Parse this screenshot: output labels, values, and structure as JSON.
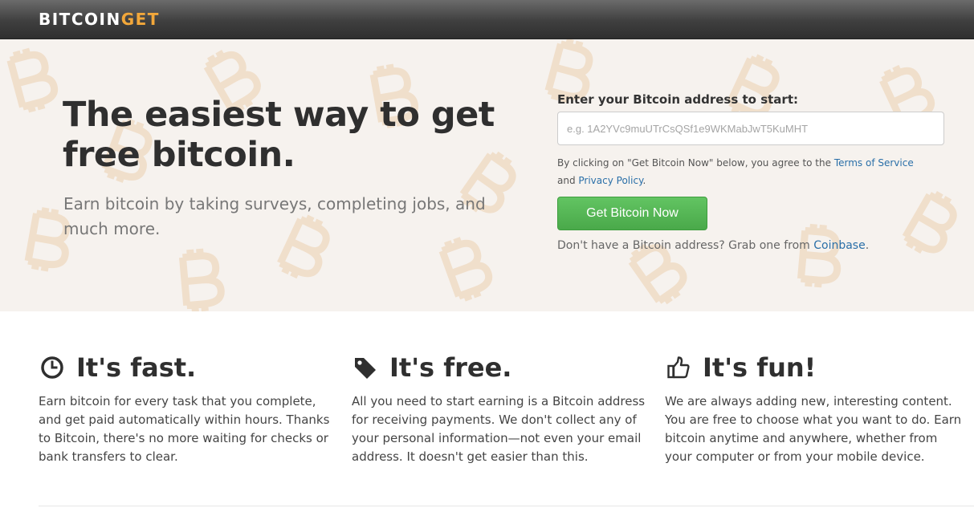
{
  "brand": {
    "part1": "BITCOIN",
    "part2": "GET",
    "accent_color": "#f2a73a"
  },
  "hero": {
    "headline": "The easiest way to get free bitcoin.",
    "subhead": "Earn bitcoin by taking surveys, completing jobs, and much more."
  },
  "signup": {
    "label": "Enter your Bitcoin address to start:",
    "placeholder": "e.g. 1A2YVc9muUTrCsQSf1e9WKMabJwT5KuMHT",
    "terms_prefix": "By clicking on \"Get Bitcoin Now\" below, you agree to the ",
    "terms_link": "Terms of Service",
    "terms_and": " and ",
    "privacy_link": "Privacy Policy",
    "terms_suffix": ".",
    "button_label": "Get Bitcoin Now",
    "button_color": "#5cb85c",
    "coinbase_prefix": "Don't have a Bitcoin address? Grab one from ",
    "coinbase_link": "Coinbase",
    "coinbase_suffix": "."
  },
  "features": [
    {
      "icon": "clock-icon",
      "title": "It's fast.",
      "text": "Earn bitcoin for every task that you complete, and get paid automatically within hours. Thanks to Bitcoin, there's no more waiting for checks or bank transfers to clear."
    },
    {
      "icon": "tag-icon",
      "title": "It's free.",
      "text": "All you need to start earning is a Bitcoin address for receiving payments. We don't collect any of your personal information—not even your email address. It doesn't get easier than this."
    },
    {
      "icon": "thumbs-up-icon",
      "title": "It's fun!",
      "text": "We are always adding new, interesting content. You are free to choose what you want to do. Earn bitcoin anytime and anywhere, whether from your computer or from your mobile device."
    }
  ],
  "colors": {
    "link": "#2a6fa8",
    "header_bg": "#3f3f3f"
  }
}
